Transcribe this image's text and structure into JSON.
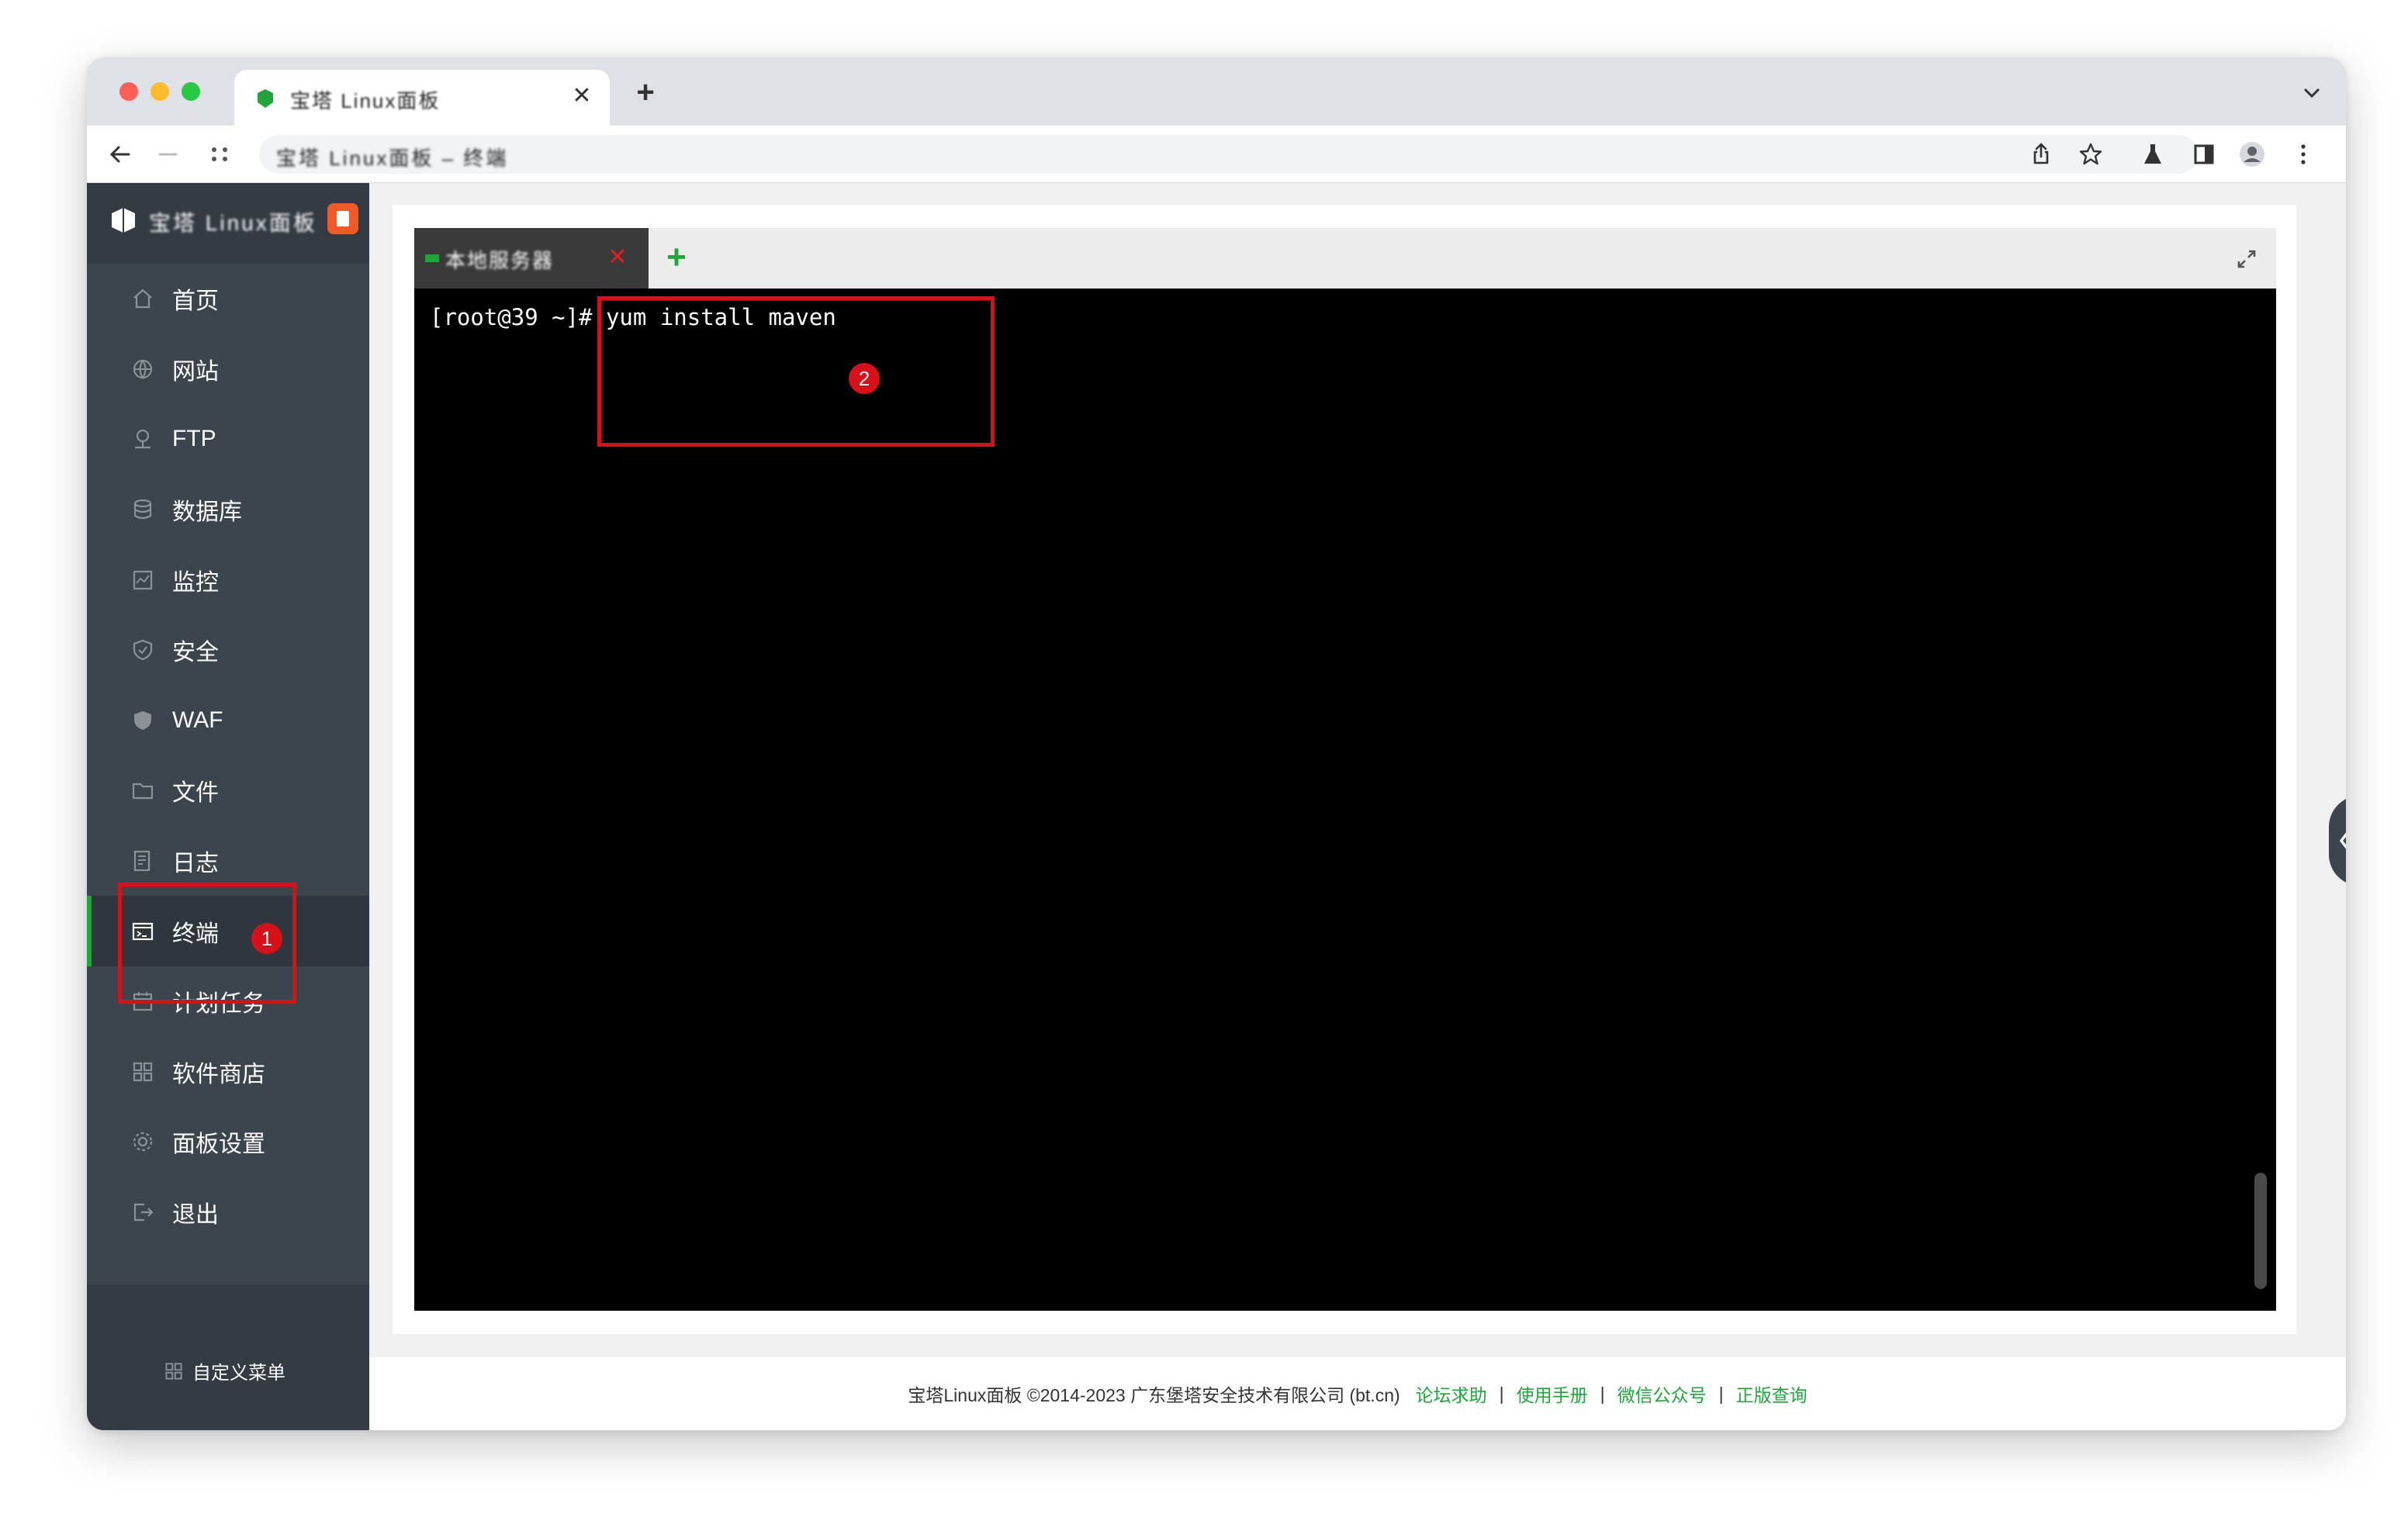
{
  "browser": {
    "tab_title": "宝塔 Linux面板",
    "omnibox_text": "宝塔 Linux面板 – 终端"
  },
  "sidebar": {
    "brand": "宝塔 Linux面板",
    "items": [
      {
        "label": "首页",
        "icon": "home-icon"
      },
      {
        "label": "网站",
        "icon": "globe-icon"
      },
      {
        "label": "FTP",
        "icon": "ftp-icon"
      },
      {
        "label": "数据库",
        "icon": "database-icon"
      },
      {
        "label": "监控",
        "icon": "monitor-icon"
      },
      {
        "label": "安全",
        "icon": "shield-icon"
      },
      {
        "label": "WAF",
        "icon": "waf-icon"
      },
      {
        "label": "文件",
        "icon": "folder-icon"
      },
      {
        "label": "日志",
        "icon": "log-icon"
      },
      {
        "label": "终端",
        "icon": "terminal-icon",
        "active": true
      },
      {
        "label": "计划任务",
        "icon": "calendar-icon"
      },
      {
        "label": "软件商店",
        "icon": "grid-icon"
      },
      {
        "label": "面板设置",
        "icon": "gear-icon"
      },
      {
        "label": "退出",
        "icon": "logout-icon"
      }
    ],
    "custom_menu": "自定义菜单"
  },
  "terminal": {
    "tab_name": "本地服务器",
    "prompt": "[root@39 ~]#",
    "command": " yum install maven"
  },
  "footer": {
    "copyright": "宝塔Linux面板 ©2014-2023 广东堡塔安全技术有限公司 (bt.cn)",
    "links": [
      "论坛求助",
      "使用手册",
      "微信公众号",
      "正版查询"
    ],
    "separator": "|"
  },
  "annotations": {
    "step1": "1",
    "step2": "2"
  },
  "colors": {
    "accent": "#20a53a",
    "sidebar_bg": "#3c444d",
    "annotation": "#d7111a"
  }
}
